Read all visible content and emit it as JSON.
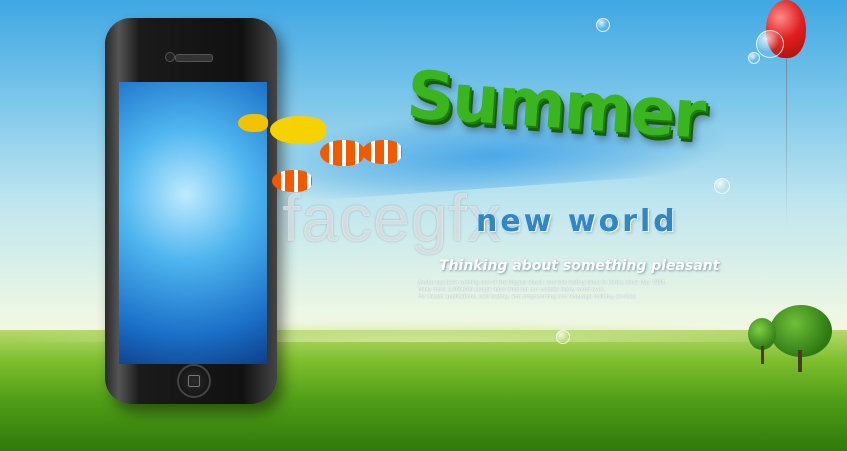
{
  "poster": {
    "title": "Summer",
    "watermark": "facegfx",
    "headline": "new world",
    "tagline": "Thinking about something pleasant",
    "body_lines": [
      "Anobe has been running one of the biggest classic and rich testing since in Karina since May 1998,",
      "Many more 3,000,000 people have tried out our website many world over,",
      "For classic applications, web testing, and programming and language building services"
    ]
  },
  "colors": {
    "sky_top": "#3fa7e3",
    "grass": "#4e9c17",
    "title_green": "#3ab51f",
    "headline_blue": "#2f86c9",
    "balloon_red": "#e02020"
  }
}
